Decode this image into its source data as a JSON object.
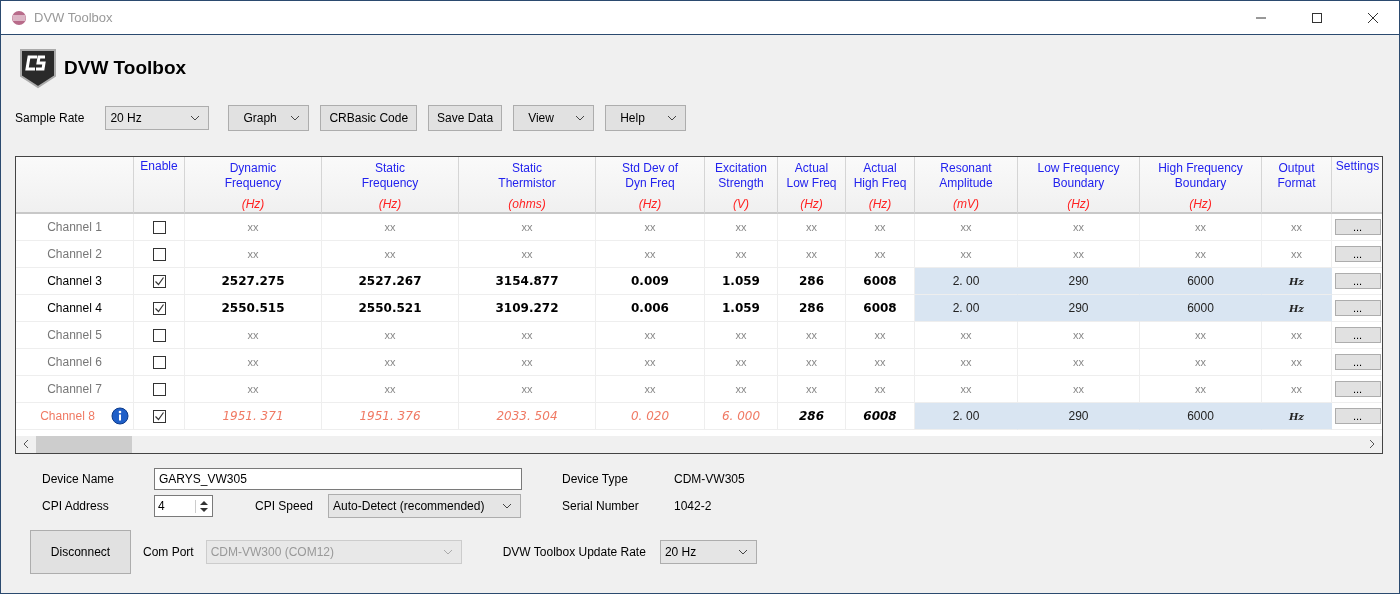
{
  "window": {
    "title": "DVW Toolbox"
  },
  "header": {
    "title": "DVW Toolbox"
  },
  "toolbar": {
    "sample_rate": {
      "label": "Sample Rate",
      "value": "20 Hz"
    },
    "buttons": [
      {
        "label": "Graph",
        "kind": "menu"
      },
      {
        "label": "CRBasic Code",
        "kind": "plain"
      },
      {
        "label": "Save Data",
        "kind": "plain"
      },
      {
        "label": "View",
        "kind": "menu"
      },
      {
        "label": "Help",
        "kind": "menu"
      }
    ]
  },
  "table": {
    "columns": [
      {
        "lines": [
          "Enable"
        ]
      },
      {
        "lines": [
          "Dynamic",
          "Frequency"
        ],
        "unit": "(Hz)"
      },
      {
        "lines": [
          "Static",
          "Frequency"
        ],
        "unit": "(Hz)"
      },
      {
        "lines": [
          "Static",
          "Thermistor"
        ],
        "unit": "(ohms)"
      },
      {
        "lines": [
          "Std Dev of",
          "Dyn Freq"
        ],
        "unit": "(Hz)"
      },
      {
        "lines": [
          "Excitation",
          "Strength"
        ],
        "unit": "(V)"
      },
      {
        "lines": [
          "Actual",
          "Low Freq"
        ],
        "unit": "(Hz)"
      },
      {
        "lines": [
          "Actual",
          "High Freq"
        ],
        "unit": "(Hz)"
      },
      {
        "lines": [
          "Resonant",
          "Amplitude"
        ],
        "unit": "(mV)"
      },
      {
        "lines": [
          "Low Frequency",
          "Boundary"
        ],
        "unit": "(Hz)"
      },
      {
        "lines": [
          "High Frequency",
          "Boundary"
        ],
        "unit": "(Hz)"
      },
      {
        "lines": [
          "Output",
          "Format"
        ]
      },
      {
        "lines": [
          "Settings"
        ]
      }
    ],
    "rows": [
      {
        "name": "Channel 1",
        "kind": "off",
        "enabled": false,
        "info": false,
        "values": [
          "xx",
          "xx",
          "xx",
          "xx",
          "xx",
          "xx",
          "xx",
          "xx",
          "xx",
          "xx",
          "xx"
        ],
        "settings": "..."
      },
      {
        "name": "Channel 2",
        "kind": "off",
        "enabled": false,
        "info": false,
        "values": [
          "xx",
          "xx",
          "xx",
          "xx",
          "xx",
          "xx",
          "xx",
          "xx",
          "xx",
          "xx",
          "xx"
        ],
        "settings": "..."
      },
      {
        "name": "Channel 3",
        "kind": "ok",
        "enabled": true,
        "info": false,
        "values": [
          "2527.275",
          "2527.267",
          "3154.877",
          "0.009",
          "1.059",
          "286",
          "6008",
          "2. 00",
          "290",
          "6000",
          "Hz"
        ],
        "settings": "..."
      },
      {
        "name": "Channel 4",
        "kind": "ok",
        "enabled": true,
        "info": false,
        "values": [
          "2550.515",
          "2550.521",
          "3109.272",
          "0.006",
          "1.059",
          "286",
          "6008",
          "2. 00",
          "290",
          "6000",
          "Hz"
        ],
        "settings": "..."
      },
      {
        "name": "Channel 5",
        "kind": "off",
        "enabled": false,
        "info": false,
        "values": [
          "xx",
          "xx",
          "xx",
          "xx",
          "xx",
          "xx",
          "xx",
          "xx",
          "xx",
          "xx",
          "xx"
        ],
        "settings": "..."
      },
      {
        "name": "Channel 6",
        "kind": "off",
        "enabled": false,
        "info": false,
        "values": [
          "xx",
          "xx",
          "xx",
          "xx",
          "xx",
          "xx",
          "xx",
          "xx",
          "xx",
          "xx",
          "xx"
        ],
        "settings": "..."
      },
      {
        "name": "Channel 7",
        "kind": "off",
        "enabled": false,
        "info": false,
        "values": [
          "xx",
          "xx",
          "xx",
          "xx",
          "xx",
          "xx",
          "xx",
          "xx",
          "xx",
          "xx",
          "xx"
        ],
        "settings": "..."
      },
      {
        "name": "Channel 8",
        "kind": "alert",
        "enabled": true,
        "info": true,
        "values": [
          "1951. 371",
          "1951. 376",
          "2033. 504",
          "0. 020",
          "6. 000",
          "286",
          "6008",
          "2. 00",
          "290",
          "6000",
          "Hz"
        ],
        "settings": "..."
      }
    ]
  },
  "device": {
    "device_name": {
      "label": "Device Name",
      "value": "GARYS_VW305"
    },
    "cpi_address": {
      "label": "CPI Address",
      "value": "4"
    },
    "cpi_speed": {
      "label": "CPI Speed",
      "value": "Auto-Detect (recommended)"
    },
    "device_type": {
      "label": "Device Type",
      "value": "CDM-VW305"
    },
    "serial_number": {
      "label": "Serial Number",
      "value": "1042-2"
    },
    "disconnect": {
      "label": "Disconnect"
    },
    "com_port": {
      "label": "Com Port",
      "value": "CDM-VW300 (COM12)",
      "disabled": true
    },
    "update_rate": {
      "label": "DVW Toolbox Update Rate",
      "value": "20 Hz"
    }
  }
}
